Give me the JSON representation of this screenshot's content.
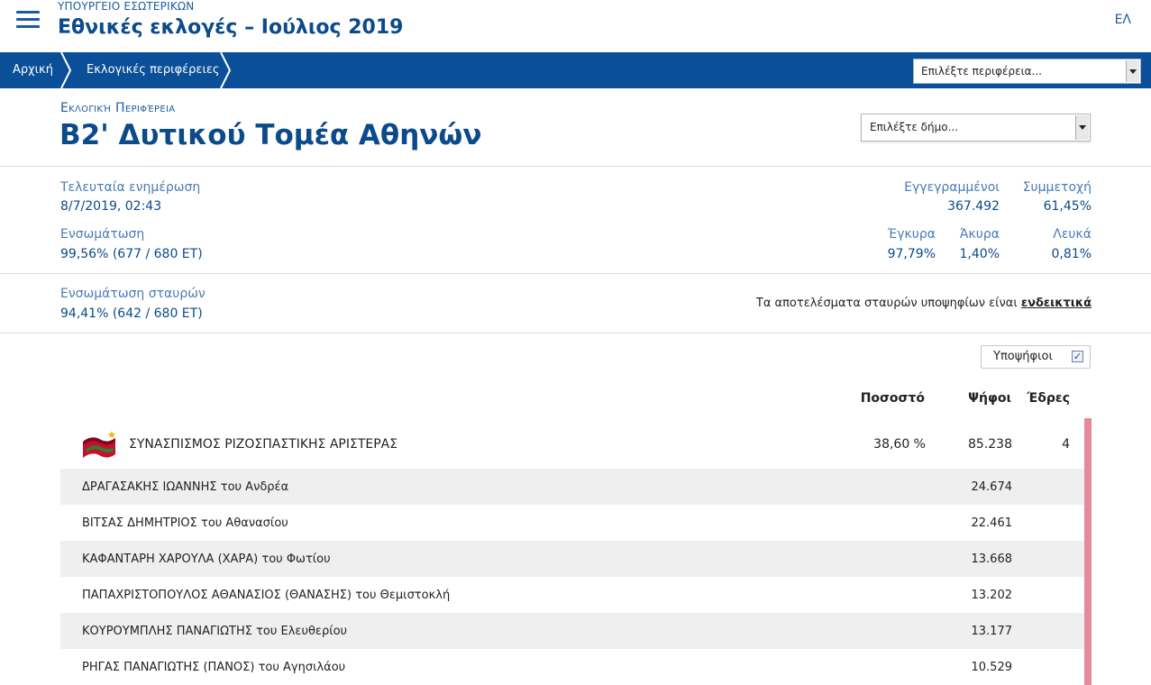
{
  "header": {
    "ministry": "ΥΠΟΥΡΓΕΙΟ ΕΣΩΤΕΡΙΚΩΝ",
    "title": "Εθνικές εκλογές – Ιούλιος 2019",
    "language": "ΕΛ"
  },
  "nav": {
    "home": "Αρχική",
    "regions": "Εκλογικές περιφέρειες",
    "region_select": "Επιλέξτε περιφέρεια..."
  },
  "district": {
    "label": "Εκλογική Περιφέρεια",
    "name": "Β2' Δυτικού Τομέα Αθηνών",
    "municipality_select": "Επιλέξτε δήμο..."
  },
  "stats": {
    "last_update_label": "Τελευταία ενημέρωση",
    "last_update_value": "8/7/2019, 02:43",
    "integration_label": "Ενσωμάτωση",
    "integration_value": "99,56% (677 / 680 ΕΤ)",
    "registered_label": "Εγγεγραμμένοι",
    "registered_value": "367.492",
    "turnout_label": "Συμμετοχή",
    "turnout_value": "61,45%",
    "valid_label": "Έγκυρα",
    "valid_value": "97,79%",
    "invalid_label": "Άκυρα",
    "invalid_value": "1,40%",
    "blank_label": "Λευκά",
    "blank_value": "0,81%",
    "pref_integration_label": "Ενσωμάτωση σταυρών",
    "pref_integration_value": "94,41% (642 / 680 ΕΤ)",
    "notice_text": "Τα αποτελέσματα σταυρών υποψηφίων είναι ",
    "notice_link": "ενδεικτικά"
  },
  "candidates_toggle": {
    "label": "Υποψήφιοι",
    "checked": true
  },
  "results": {
    "columns": {
      "percent": "Ποσοστό",
      "votes": "Ψήφοι",
      "seats": "Έδρες"
    },
    "party": {
      "name": "ΣΥΝΑΣΠΙΣΜΟΣ ΡΙΖΟΣΠΑΣΤΙΚΗΣ ΑΡΙΣΤΕΡΑΣ",
      "percent": "38,60 %",
      "votes": "85.238",
      "seats": "4",
      "color": "#e6899a"
    },
    "candidates": [
      {
        "name": "ΔΡΑΓΑΣΑΚΗΣ ΙΩΑΝΝΗΣ του Ανδρέα",
        "votes": "24.674"
      },
      {
        "name": "ΒΙΤΣΑΣ ΔΗΜΗΤΡΙΟΣ του Αθανασίου",
        "votes": "22.461"
      },
      {
        "name": "ΚΑΦΑΝΤΑΡΗ ΧΑΡΟΥΛΑ (ΧΑΡΑ) του Φωτίου",
        "votes": "13.668"
      },
      {
        "name": "ΠΑΠΑΧΡΙΣΤΟΠΟΥΛΟΣ ΑΘΑΝΑΣΙΟΣ (ΘΑΝΑΣΗΣ) του Θεμιστοκλή",
        "votes": "13.202"
      },
      {
        "name": "ΚΟΥΡΟΥΜΠΛΗΣ ΠΑΝΑΓΙΩΤΗΣ του Ελευθερίου",
        "votes": "13.177"
      },
      {
        "name": "ΡΗΓΑΣ ΠΑΝΑΓΙΩΤΗΣ (ΠΑΝΟΣ) του Αγησιλάου",
        "votes": "10.529"
      }
    ]
  }
}
